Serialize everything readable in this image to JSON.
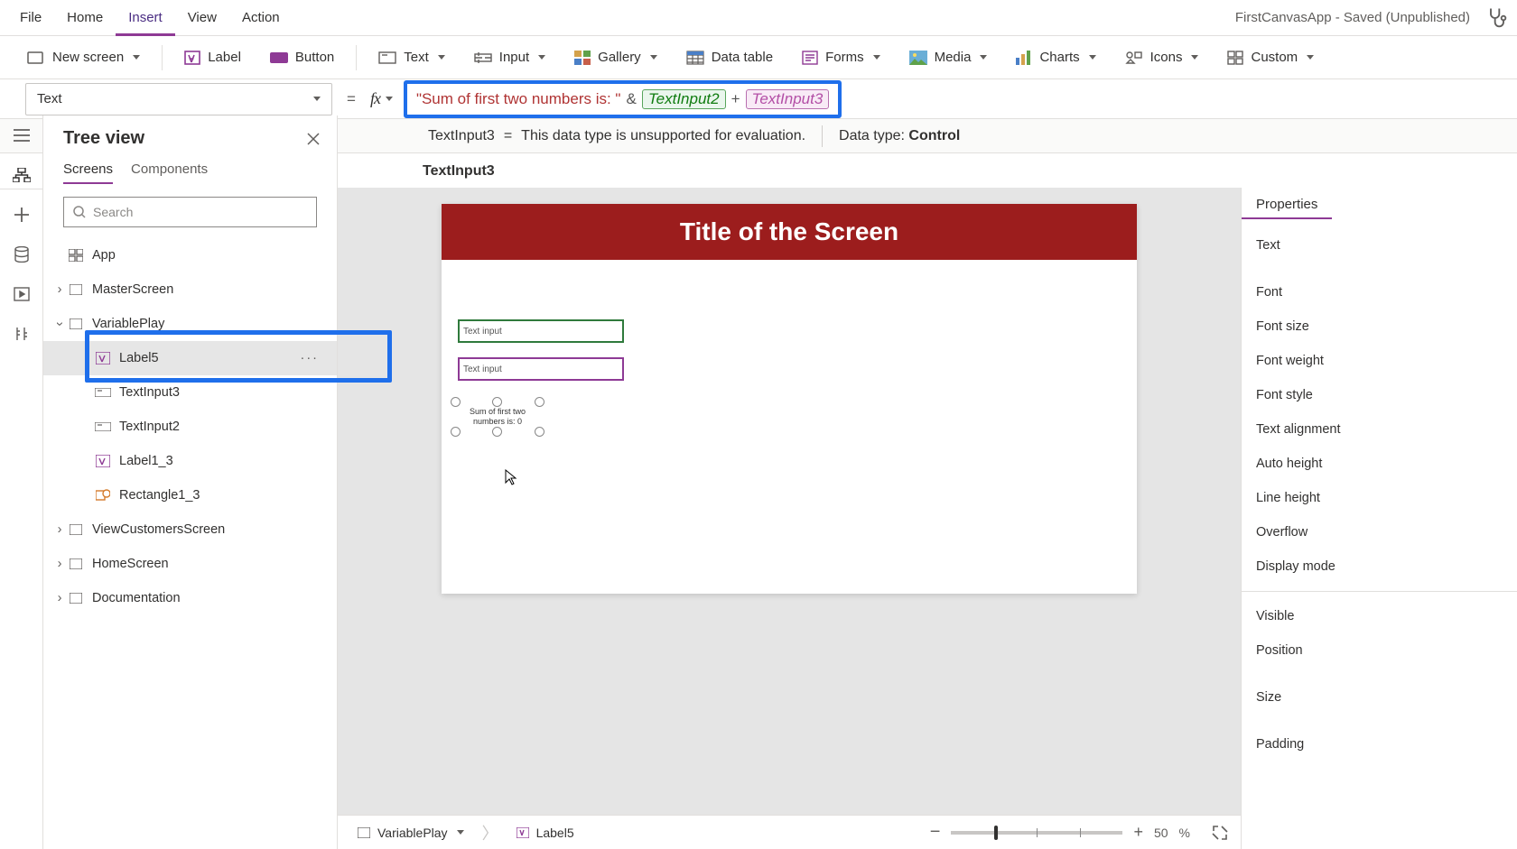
{
  "menubar": {
    "file": "File",
    "home": "Home",
    "insert": "Insert",
    "view": "View",
    "action": "Action",
    "title": "FirstCanvasApp - Saved (Unpublished)"
  },
  "ribbon": {
    "newscreen": "New screen",
    "label": "Label",
    "button": "Button",
    "text": "Text",
    "input": "Input",
    "gallery": "Gallery",
    "datatable": "Data table",
    "forms": "Forms",
    "media": "Media",
    "charts": "Charts",
    "icons": "Icons",
    "custom": "Custom"
  },
  "formula": {
    "prop": "Text",
    "string_part": "\"Sum of first two numbers is: \"",
    "amp": "&",
    "token1": "TextInput2",
    "plus": "+",
    "token2": "TextInput3"
  },
  "eval": {
    "lhs": "TextInput3",
    "eq": "=",
    "msg": "This data type is unsupported for evaluation.",
    "dt_label": "Data type:",
    "dt_value": "Control"
  },
  "intel": {
    "text": "TextInput3"
  },
  "tree": {
    "title": "Tree view",
    "tab_screens": "Screens",
    "tab_components": "Components",
    "search_placeholder": "Search",
    "app": "App",
    "items": [
      {
        "label": "MasterScreen"
      },
      {
        "label": "VariablePlay"
      },
      {
        "label": "Label5"
      },
      {
        "label": "TextInput3"
      },
      {
        "label": "TextInput2"
      },
      {
        "label": "Label1_3"
      },
      {
        "label": "Rectangle1_3"
      },
      {
        "label": "ViewCustomersScreen"
      },
      {
        "label": "HomeScreen"
      },
      {
        "label": "Documentation"
      }
    ]
  },
  "canvas": {
    "title": "Title of the Screen",
    "input1": "Text input",
    "input2": "Text input",
    "label_text": "Sum of first two numbers is: 0"
  },
  "props": {
    "tab": "Properties",
    "rows1": [
      "Text",
      "Font",
      "Font size",
      "Font weight",
      "Font style",
      "Text alignment",
      "Auto height",
      "Line height",
      "Overflow",
      "Display mode"
    ],
    "rows2": [
      "Visible",
      "Position",
      "Size",
      "Padding"
    ]
  },
  "footer": {
    "screen": "VariablePlay",
    "control": "Label5",
    "zoom_pct": "50",
    "zoom_suffix": "%"
  }
}
